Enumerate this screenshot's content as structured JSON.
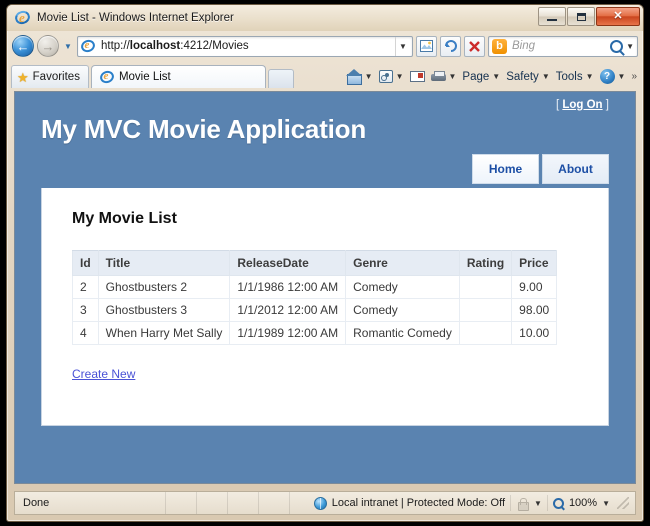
{
  "window": {
    "title": "Movie List - Windows Internet Explorer",
    "app_icon": "ie-logo-icon",
    "minimize_label": "Minimize",
    "maximize_label": "Maximize",
    "close_label": "Close"
  },
  "navbar": {
    "back_label": "Back",
    "forward_label": "Forward",
    "recent_pages_label": "Recent Pages",
    "url_prefix": "http://",
    "url_host": "localhost",
    "url_suffix": ":4212/Movies",
    "address_dropdown": "Address dropdown",
    "compat_label": "Compatibility View",
    "refresh_label": "Refresh",
    "stop_label": "Stop",
    "search_engine": "Bing",
    "search_placeholder": "Bing",
    "search_value": "",
    "search_dropdown": "Search options"
  },
  "tabbar": {
    "favorites_label": "Favorites",
    "favorites_icon": "star-icon",
    "tabs": [
      {
        "label": "Movie List",
        "icon": "ie-logo-icon",
        "active": true
      }
    ],
    "new_tab_label": "New Tab",
    "commands": [
      {
        "label": "",
        "icon": "home-icon",
        "has_caret": true
      },
      {
        "label": "",
        "icon": "rss-feeds-icon",
        "has_caret": true
      },
      {
        "label": "",
        "icon": "mail-icon",
        "has_caret": false
      },
      {
        "label": "",
        "icon": "print-icon",
        "has_caret": true
      },
      {
        "label": "Page",
        "icon": "",
        "has_caret": true
      },
      {
        "label": "Safety",
        "icon": "",
        "has_caret": true
      },
      {
        "label": "Tools",
        "icon": "",
        "has_caret": true
      },
      {
        "label": "",
        "icon": "help-icon",
        "has_caret": true
      }
    ],
    "overflow_label": "»"
  },
  "page": {
    "logon_open_bracket": "[",
    "logon_label": "Log On",
    "logon_close_bracket": "]",
    "site_title": "My MVC Movie Application",
    "menu": [
      {
        "label": "Home",
        "active": true
      },
      {
        "label": "About",
        "active": false
      }
    ],
    "heading": "My Movie List",
    "create_new_label": "Create New",
    "table": {
      "columns": [
        "Id",
        "Title",
        "ReleaseDate",
        "Genre",
        "Rating",
        "Price"
      ],
      "rows": [
        {
          "id": "2",
          "title": "Ghostbusters 2",
          "release_date": "1/1/1986 12:00 AM",
          "genre": "Comedy",
          "rating": "",
          "price": "9.00"
        },
        {
          "id": "3",
          "title": "Ghostbusters 3",
          "release_date": "1/1/2012 12:00 AM",
          "genre": "Comedy",
          "rating": "",
          "price": "98.00"
        },
        {
          "id": "4",
          "title": "When Harry Met Sally",
          "release_date": "1/1/1989 12:00 AM",
          "genre": "Romantic Comedy",
          "rating": "",
          "price": "10.00"
        }
      ]
    }
  },
  "statusbar": {
    "status_text": "Done",
    "zone_icon": "globe-icon",
    "zone_text": "Local intranet | Protected Mode: Off",
    "privacy_icon": "lock-icon",
    "zoom_level": "100%",
    "zoom_icon": "zoom-icon"
  },
  "colors": {
    "page_background": "#5a83b0",
    "content_background": "#ffffff",
    "menu_text": "#1d4fa5",
    "link": "#4a52d6",
    "table_header": "#e6ecf4",
    "close_button": "#c8431c"
  }
}
